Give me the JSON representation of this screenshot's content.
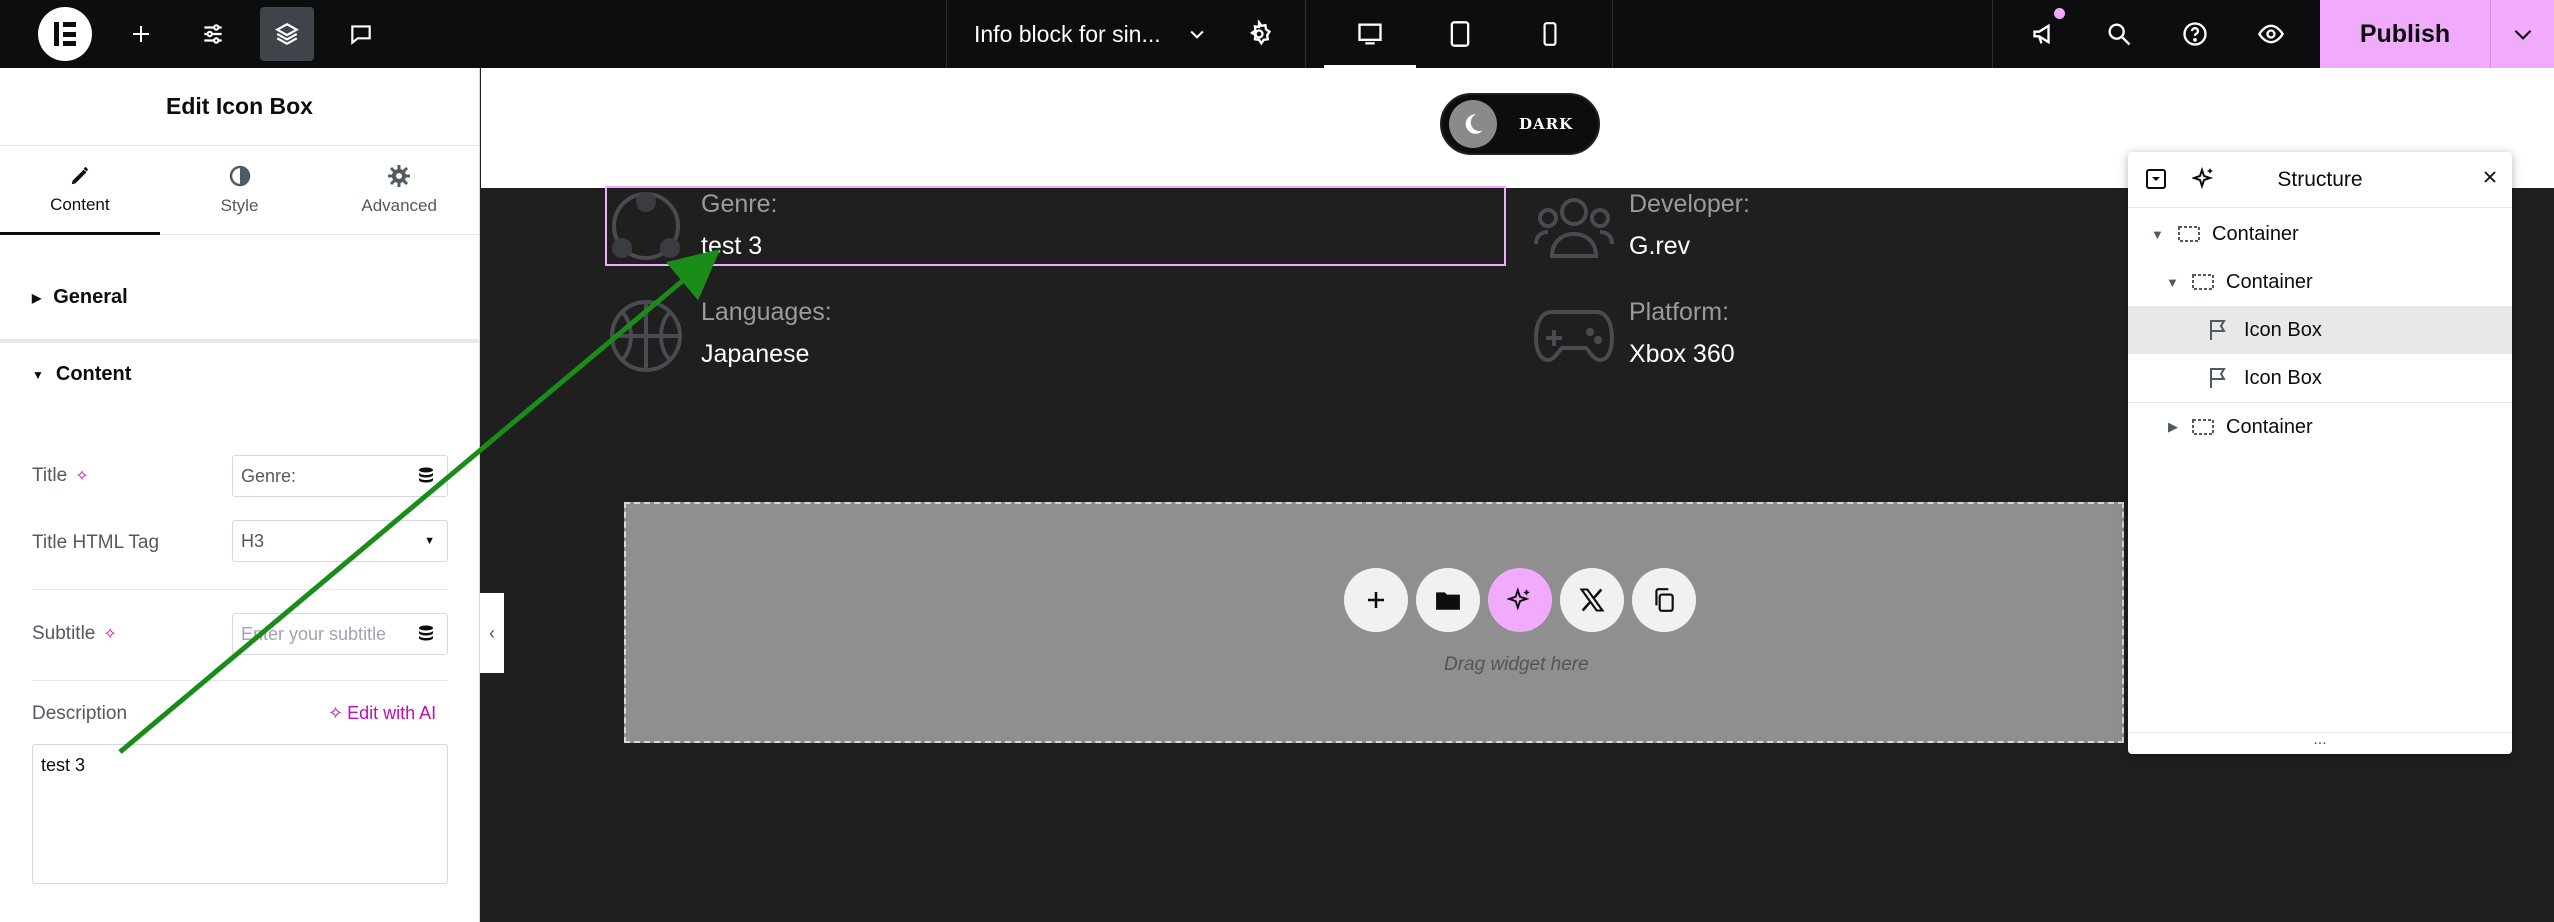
{
  "topbar": {
    "doc_title": "Info block for sin...",
    "publish_label": "Publish",
    "icons": [
      "elementor-logo-icon",
      "add-element-icon",
      "site-settings-icon",
      "structure-layers-icon",
      "comments-icon",
      "page-settings-gear-icon",
      "desktop-icon",
      "tablet-icon",
      "mobile-icon",
      "whats-new-megaphone-icon",
      "search-icon",
      "help-icon",
      "preview-eye-icon",
      "publish-chevron-icon"
    ]
  },
  "panel": {
    "title": "Edit Icon Box",
    "tabs": [
      {
        "label": "Content",
        "icon": "pencil-icon"
      },
      {
        "label": "Style",
        "icon": "half-circle-icon"
      },
      {
        "label": "Advanced",
        "icon": "gear-icon"
      }
    ],
    "sections": {
      "general": "General",
      "content": "Content"
    },
    "fields": {
      "title_label": "Title",
      "title_value": "Genre:",
      "title_tag_label": "Title HTML Tag",
      "title_tag_value": "H3",
      "subtitle_label": "Subtitle",
      "subtitle_placeholder": "Enter your subtitle",
      "description_label": "Description",
      "edit_with_ai": "Edit with AI",
      "description_value": "test 3"
    }
  },
  "canvas": {
    "toggle_label": "DARK",
    "items": [
      {
        "label": "Genre:",
        "value": "test 3",
        "icon": "people-network-icon"
      },
      {
        "label": "Developer:",
        "value": "G.rev",
        "icon": "users-group-icon"
      },
      {
        "label": "Languages:",
        "value": "Japanese",
        "icon": "basketball-globe-icon"
      },
      {
        "label": "Platform:",
        "value": "Xbox 360",
        "icon": "gamepad-icon"
      }
    ],
    "drop_zone_text": "Drag widget here"
  },
  "structure": {
    "title": "Structure",
    "rows": [
      {
        "name": "Container",
        "arrow": "expanded",
        "icon": "container-icon"
      },
      {
        "name": "Container",
        "arrow": "expanded",
        "icon": "container-icon"
      },
      {
        "name": "Icon Box",
        "arrow": "none",
        "icon": "flag-icon",
        "selected": true
      },
      {
        "name": "Icon Box",
        "arrow": "none",
        "icon": "flag-icon"
      },
      {
        "name": "Container",
        "arrow": "collapsed",
        "icon": "container-icon"
      }
    ],
    "footer": "..."
  },
  "colors": {
    "accent": "#f0abfc",
    "ai_magenta": "#c00bb9",
    "topbar_bg": "#0c0d0e",
    "canvas_bg": "#1f1f20",
    "annotation_arrow": "#1a8c1a"
  }
}
